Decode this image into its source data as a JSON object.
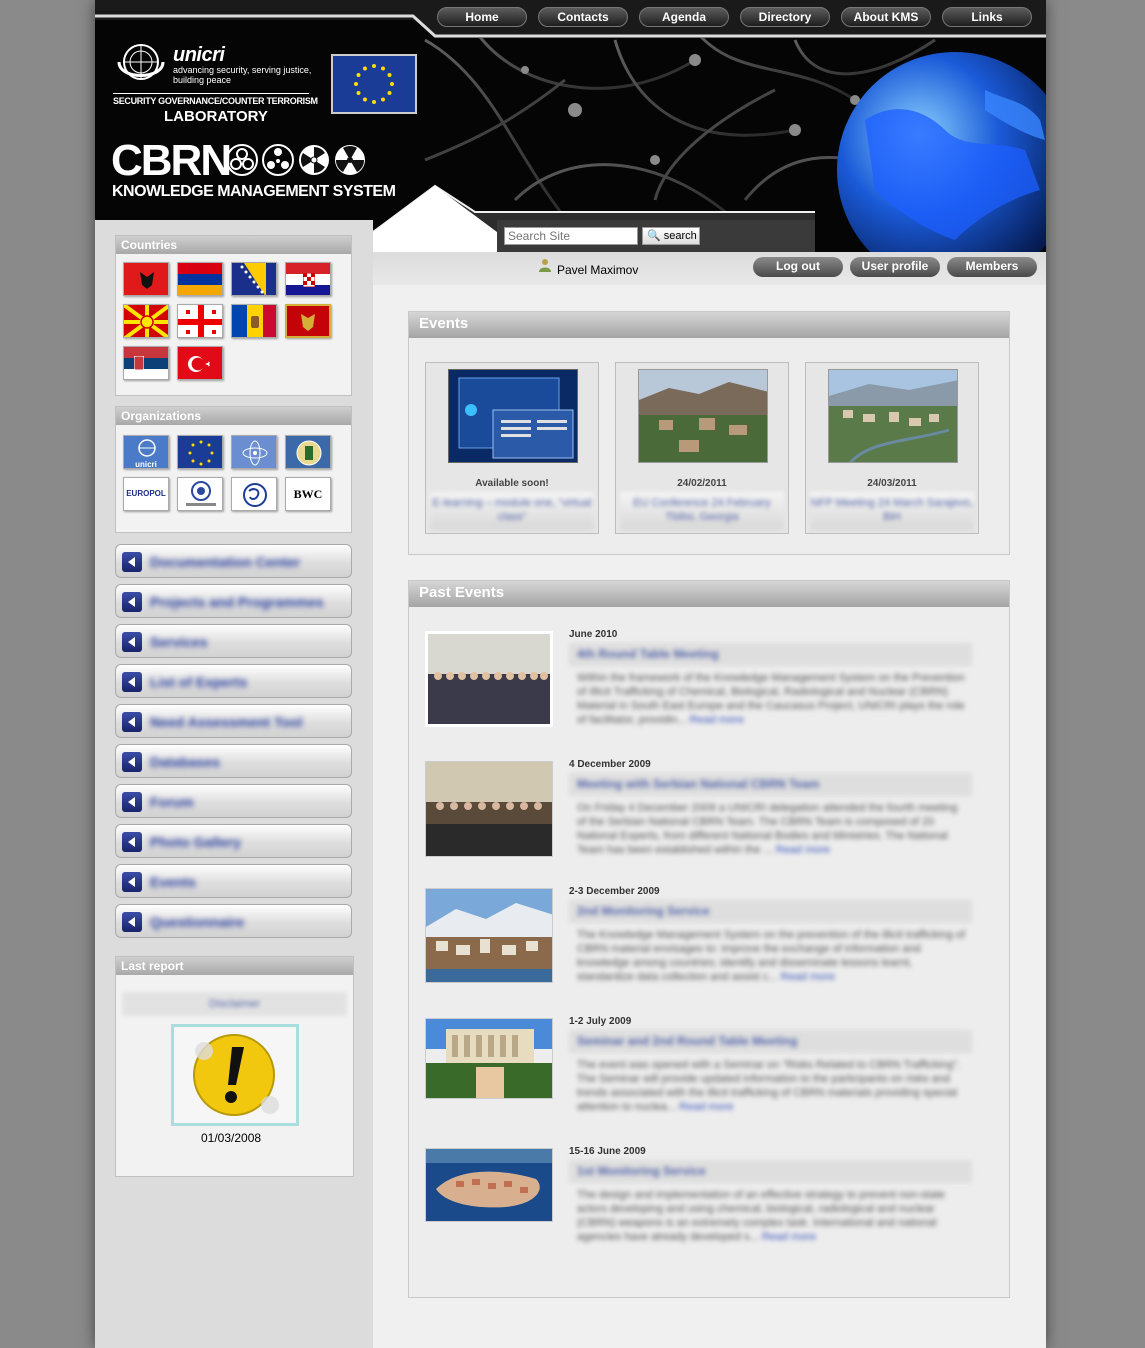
{
  "nav": {
    "items": [
      "Home",
      "Contacts",
      "Agenda",
      "Directory",
      "About KMS",
      "Links"
    ]
  },
  "branding": {
    "org_name": "unicri",
    "org_tagline": "advancing security, serving justice, building peace",
    "lab_line1": "SECURITY GOVERNANCE/COUNTER TERRORISM",
    "lab_line2": "LABORATORY",
    "product": "CBRN",
    "product_sub": "KNOWLEDGE MANAGEMENT SYSTEM"
  },
  "search": {
    "placeholder": "Search Site",
    "button": "search"
  },
  "user": {
    "name": "Pavel Maximov",
    "buttons": [
      "Log out",
      "User profile",
      "Members"
    ]
  },
  "sidebar": {
    "countries_title": "Countries",
    "countries": [
      "Albania",
      "Armenia",
      "Bosnia and Herzegovina",
      "Croatia",
      "Macedonia",
      "Georgia",
      "Moldova",
      "Montenegro",
      "Serbia",
      "Turkey"
    ],
    "organizations_title": "Organizations",
    "organizations": [
      "unicri",
      "EU",
      "IAEA",
      "OPCW",
      "EUROPOL",
      "WCO",
      "CoE",
      "BWC"
    ],
    "menu": [
      "Documentation Center",
      "Projects and Programmes",
      "Services",
      "List of Experts",
      "Need Assessment Tool",
      "Databases",
      "Forum",
      "Photo Gallery",
      "Events",
      "Questionnaire"
    ],
    "report_title": "Last report",
    "report_link": "Disclaimer",
    "report_date": "01/03/2008"
  },
  "events": {
    "title": "Events",
    "cards": [
      {
        "date": "Available soon!",
        "title": "E-learning – module one, “virtual class”"
      },
      {
        "date": "24/02/2011",
        "title": "EU Conference 24 February Tbilisi, Georgia"
      },
      {
        "date": "24/03/2011",
        "title": "NFP Meeting 24 March Sarajevo, BiH"
      }
    ]
  },
  "past_events": {
    "title": "Past Events",
    "items": [
      {
        "date": "June 2010",
        "title": "4th Round Table Meeting",
        "body": "Within the framework of the Knowledge Management System on the Prevention of Illicit Trafficking of Chemical, Biological, Radiological and Nuclear (CBRN) Material in South East Europe and the Caucasus Project, UNICRI plays the role of facilitator, providin...",
        "more": "Read more"
      },
      {
        "date": "4 December 2009",
        "title": "Meeting with Serbian National CBRN Team",
        "body": "On Friday 4 December 2009 a UNICRI delegation attended the fourth meeting of the Serbian National CBRN Team. The CBRN Team is composed of 20 National Experts, from different National Bodies and Ministries. The National Team has been established within the ...",
        "more": "Read more"
      },
      {
        "date": "2-3 December 2009",
        "title": "2nd Monitoring Service",
        "body": "The Knowledge Management System on the prevention of the illicit trafficking of CBRN material envisages to: improve the exchange of information and knowledge among countries; identify and disseminate lessons learnt, standardize data collection and assist c...",
        "more": "Read more"
      },
      {
        "date": "1-2 July 2009",
        "title": "Seminar and 2nd Round Table Meeting",
        "body": "The event was opened with a Seminar on “Risks Related to CBRN Trafficking”. The Seminar will provide updated information to the participants on risks and trends associated with the illicit trafficking of CBRN materials providing special attention to nuclea...",
        "more": "Read more"
      },
      {
        "date": "15-16 June 2009",
        "title": "1st Monitoring Service",
        "body": "The design and implementation of an effective strategy to prevent non-state actors developing and using chemical, biological, radiological and nuclear (CBRN) weapons is an extremely complex task. International and national agencies have already developed s...",
        "more": "Read more"
      }
    ]
  },
  "colors": {
    "panel_head": "#a8a8a8",
    "link_blue": "#3a55bb",
    "menu_arrow": "#18236a"
  }
}
